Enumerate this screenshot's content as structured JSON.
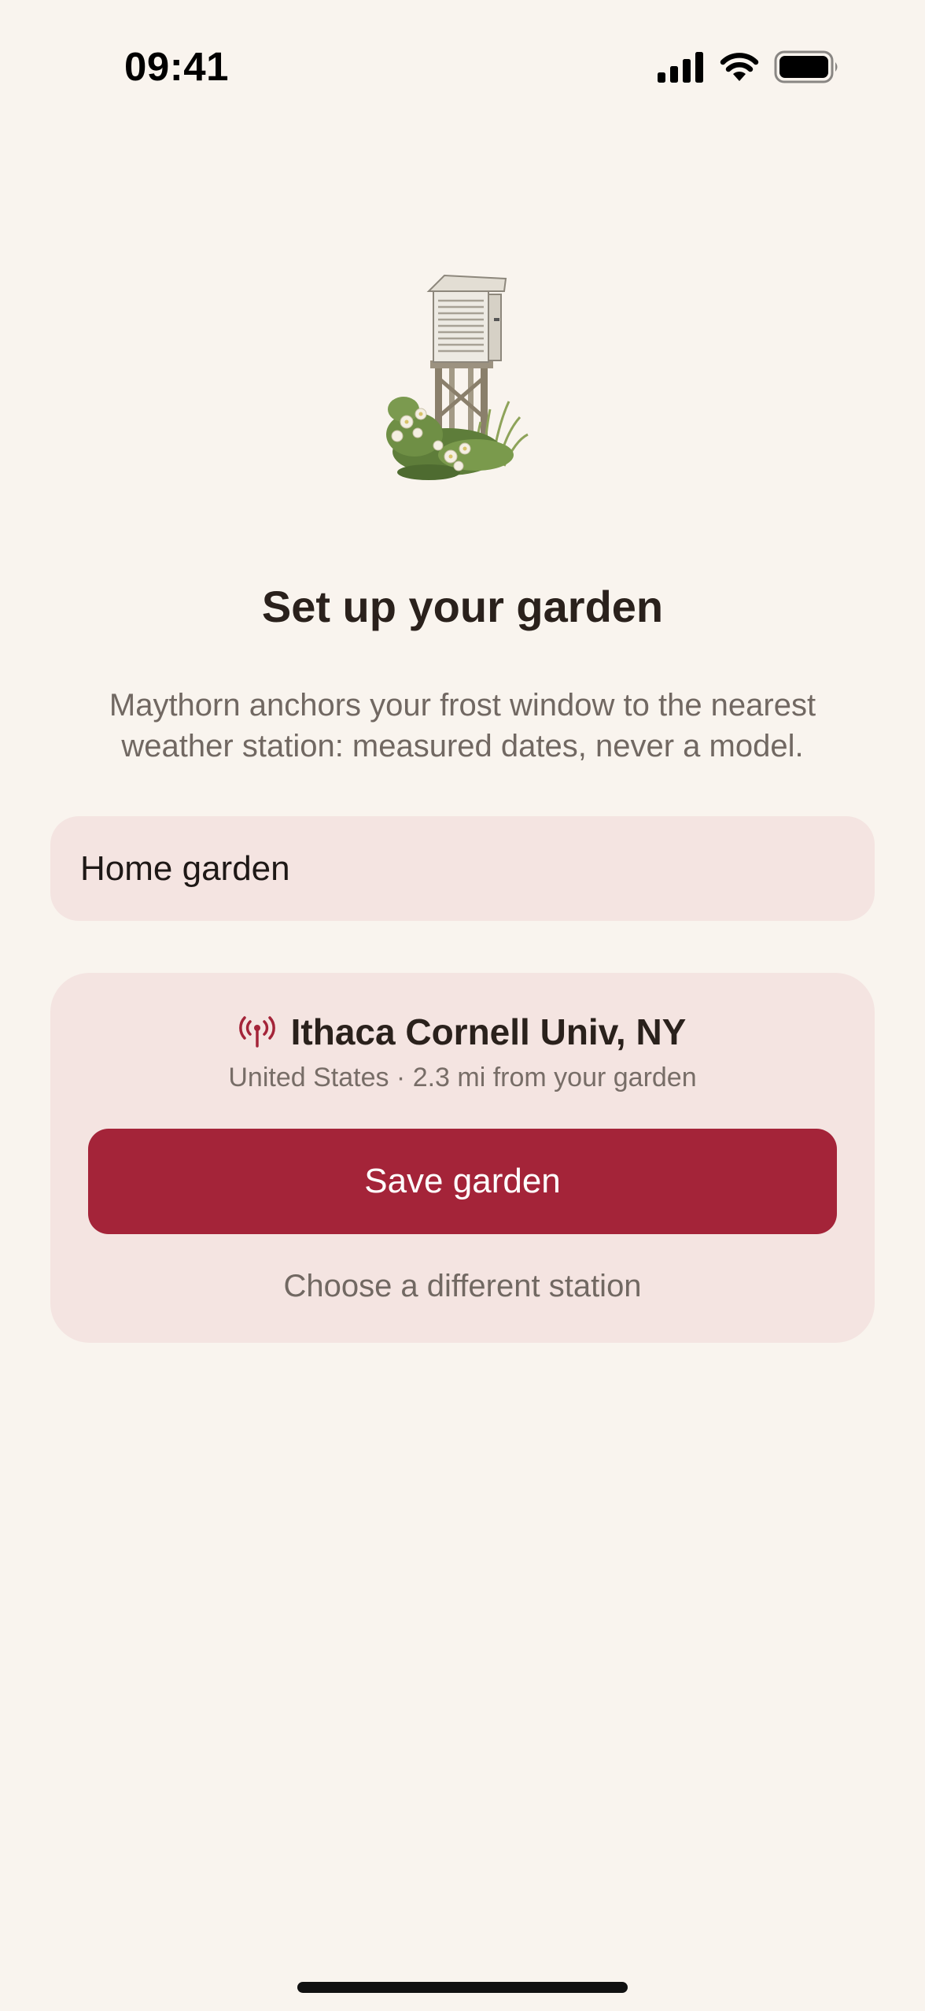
{
  "status_bar": {
    "time": "09:41",
    "icons": [
      "signal-icon",
      "wifi-icon",
      "battery-icon"
    ]
  },
  "hero": {
    "illustration": "weather-station-illustration"
  },
  "header": {
    "title": "Set up your garden",
    "subtitle": "Maythorn anchors your frost window to the nearest weather station: measured dates, never a model."
  },
  "form": {
    "garden_name_value": "Home garden"
  },
  "station": {
    "icon": "antenna-icon",
    "name": "Ithaca Cornell Univ, NY",
    "meta": "United States · 2.3 mi from your garden",
    "save_label": "Save garden",
    "change_label": "Choose a different station"
  },
  "colors": {
    "background": "#F9F4EE",
    "card": "#F4E4E1",
    "accent": "#A42439",
    "text": "#2A211C",
    "muted": "#716862"
  }
}
